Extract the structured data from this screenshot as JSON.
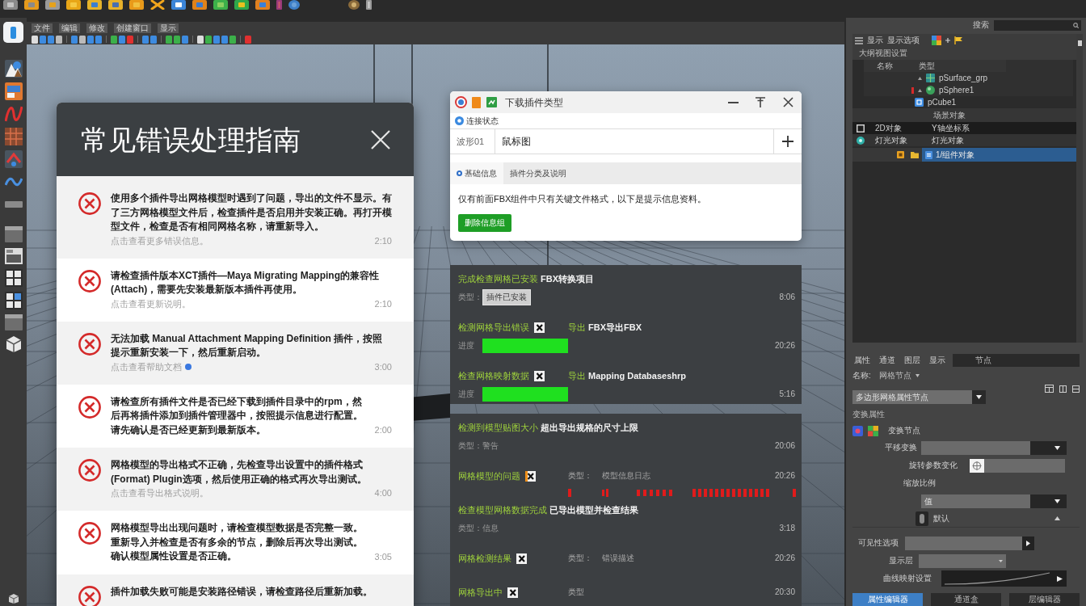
{
  "toolbar": {
    "menus": [
      "文件",
      "编辑",
      "修改",
      "创建窗口",
      "显示"
    ]
  },
  "guide": {
    "title": "常见错误处理指南",
    "items": [
      {
        "message": "使用多个插件导出网格模型时遇到了问题，导出的文件不显示。有了三方网格模型文件后，检查插件是否启用并安装正确。再打开模型文件，检查是否有相同网格名称，请重新导入。",
        "hint": "点击查看更多错误信息。",
        "time": "2:10",
        "unread": false
      },
      {
        "message": "请检查插件版本XCT插件—Maya Migrating Mapping的兼容性(Attach)，需要先安装最新版本插件再使用。",
        "hint": "点击查看更新说明。",
        "time": "2:10",
        "unread": false
      },
      {
        "message": "无法加载 Manual Attachment Mapping Definition 插件，按照提示重新安装一下，然后重新启动。",
        "hint": "点击查看帮助文档",
        "time": "3:00",
        "unread": true
      },
      {
        "message": "请检查所有插件文件是否已经下载到插件目录中的rpm，然后再将插件添加到插件管理器中，按照提示信息进行配置。请先确认是否已经更新到最新版本。",
        "time": "2:00",
        "unread": false
      },
      {
        "message": "网格模型的导出格式不正确，先检查导出设置中的插件格式(Format) Plugin选项，然后使用正确的格式再次导出测试。",
        "hint": "点击查看导出格式说明。",
        "time": "4:00",
        "unread": false
      },
      {
        "message": "网格模型导出出现问题时，请检查模型数据是否完整一致。重新导入并检查是否有多余的节点，删除后再次导出测试。确认模型属性设置是否正确。",
        "time": "3:05",
        "unread": false
      },
      {
        "message": "插件加载失败可能是安装路径错误，请检查路径后重新加载。",
        "unread": false
      }
    ]
  },
  "plugin_window": {
    "title": "下载插件类型",
    "status": "连接状态",
    "field": {
      "label": "波形01",
      "value": "鼠标图"
    },
    "tabs": [
      {
        "label": "基础信息",
        "selected": true
      },
      {
        "label": "插件分类及说明",
        "selected": false
      }
    ],
    "message": "仅有前面FBX组件中只有关键文件格式，以下是提示信息资料。",
    "button": "删除信息组"
  },
  "log_panels": [
    {
      "items": [
        {
          "kind": "tag",
          "title": [
            {
              "text": "完成检查网格已安装",
              "highlight": true
            },
            {
              "text": "FBX转换项目",
              "highlight": false
            }
          ],
          "flagged": false,
          "label": "类型：",
          "tag": "插件已安装",
          "time": "8:06"
        },
        {
          "kind": "progress",
          "title": [
            {
              "text": "检测网格导出错误",
              "highlight": true
            }
          ],
          "flagged": true,
          "flag_accent": false,
          "note": [
            {
              "text": "导出",
              "highlight": true
            },
            {
              "text": "FBX导出FBX",
              "highlight": false
            }
          ],
          "label": "进度",
          "level": 1,
          "time": "20:26"
        },
        {
          "kind": "progress",
          "title": [
            {
              "text": "检查网格映射数据",
              "highlight": true
            }
          ],
          "flagged": true,
          "flag_accent": false,
          "note": [
            {
              "text": "导出",
              "highlight": true
            },
            {
              "text": "Mapping Databaseshrp",
              "highlight": false
            }
          ],
          "label": "进度",
          "level": 1,
          "time": "5:16"
        }
      ]
    },
    {
      "items": [
        {
          "kind": "note",
          "title": [
            {
              "text": "检测到模型贴图大小",
              "highlight": true
            },
            {
              "text": "超出导出规格的尺寸上限",
              "highlight": false
            }
          ],
          "flagged": false,
          "label": "类型：警告",
          "time": "20:06"
        },
        {
          "kind": "entry",
          "title": [
            {
              "text": "网格模型的问题",
              "highlight": true
            }
          ],
          "flagged": true,
          "flag_accent": true,
          "detail": [
            "类型：",
            "模型信息日志"
          ],
          "time": "20:26",
          "error_marks": true
        },
        {
          "kind": "note",
          "title": [
            {
              "text": "检查模型网格数据完成",
              "highlight": true
            },
            {
              "text": "已导出模型并检查结果",
              "highlight": false
            }
          ],
          "flagged": false,
          "label": "类型：信息",
          "time": "3:18"
        },
        {
          "kind": "entry",
          "title": [
            {
              "text": "网格检测结果",
              "highlight": true
            }
          ],
          "flagged": true,
          "flag_accent": false,
          "detail": [
            "类型：",
            "错误描述"
          ],
          "time": "20:26",
          "error_marks": false
        },
        {
          "kind": "entry",
          "title": [
            {
              "text": "网格导出中",
              "highlight": true
            }
          ],
          "flagged": true,
          "flag_accent": false,
          "detail": [
            "类型"
          ],
          "time": "20:30",
          "error_marks": false
        }
      ]
    }
  ],
  "outliner": {
    "search_label": "搜索",
    "menu": [
      "显示",
      "显示选项"
    ],
    "options": "大纲视图设置",
    "columns": [
      "名称",
      "类型"
    ],
    "nodes": [
      {
        "name": "pSurface_grp",
        "expandable": true,
        "error": false
      },
      {
        "name": "pSphere1",
        "expandable": true,
        "error": true
      },
      {
        "name": "pCube1",
        "expandable": false,
        "error": false
      }
    ],
    "section": "场景对象",
    "entries": [
      {
        "kind": "row",
        "name": "2D对象",
        "type": "Y轴坐标系",
        "selected": false
      },
      {
        "kind": "row",
        "name": "灯光对象",
        "type": "灯光对象",
        "selected": false
      },
      {
        "kind": "component",
        "type": "1/组件对象",
        "selected": true
      }
    ]
  },
  "attributes": {
    "tabs": [
      {
        "label": "属性",
        "selected": false
      },
      {
        "label": "通道",
        "selected": false
      },
      {
        "label": "图层",
        "selected": false
      },
      {
        "label": "显示",
        "selected": false
      }
    ],
    "tab_field": "节点",
    "name_label": "名称:",
    "name_value": "网格节点",
    "node_type": "多边形网格属性节点",
    "section": "变换属性",
    "node_label": "变换节点",
    "rows": [
      {
        "kind": "dropdown",
        "label": "平移变换"
      },
      {
        "kind": "swatch",
        "label": "旋转参数变化"
      },
      {
        "kind": "heading",
        "label": "缩放比例"
      },
      {
        "kind": "dropdown",
        "value": "值"
      },
      {
        "kind": "toggle",
        "label": "默认"
      },
      {
        "kind": "number",
        "label": "可见性选项"
      },
      {
        "kind": "field",
        "label": "显示层"
      },
      {
        "kind": "curve",
        "label": "曲线映射设置"
      }
    ],
    "bottom_tabs": [
      {
        "label": "属性编辑器",
        "selected": true
      },
      {
        "label": "通道盒",
        "selected": false
      },
      {
        "label": "层编辑器",
        "selected": false
      }
    ]
  }
}
